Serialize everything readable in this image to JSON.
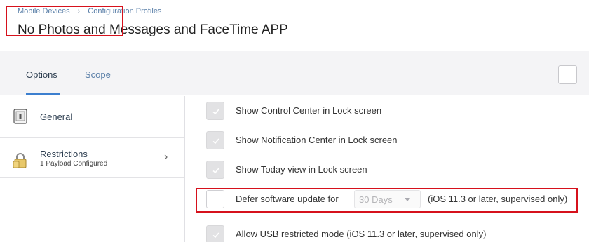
{
  "breadcrumb": {
    "items": [
      "Mobile Devices",
      "Configuration Profiles"
    ],
    "separator": "›"
  },
  "page": {
    "title": "No Photos and Messages and FaceTime APP"
  },
  "tabs": [
    {
      "label": "Options",
      "active": true
    },
    {
      "label": "Scope",
      "active": false
    }
  ],
  "sidebar": {
    "items": [
      {
        "label": "General",
        "icon": "device-icon"
      },
      {
        "label": "Restrictions",
        "sublabel": "1 Payload Configured",
        "icon": "padlock-icon",
        "chevron": "›"
      }
    ]
  },
  "settings": {
    "rows": [
      {
        "label": "Show Control Center in Lock screen",
        "checked": true,
        "disabled": true
      },
      {
        "label": "Show Notification Center in Lock screen",
        "checked": true,
        "disabled": true
      },
      {
        "label": "Show Today view in Lock screen",
        "checked": true,
        "disabled": true
      },
      {
        "label": "Defer software update for",
        "checked": false,
        "select_value": "30 Days",
        "note": "(iOS 11.3 or later, supervised only)"
      },
      {
        "label": "Allow USB restricted mode (iOS 11.3 or later, supervised only)",
        "checked": true,
        "disabled": true
      }
    ]
  },
  "colors": {
    "link": "#5a7fa8",
    "highlight": "#d6111c",
    "active_tab_underline": "#3c7fcf"
  }
}
